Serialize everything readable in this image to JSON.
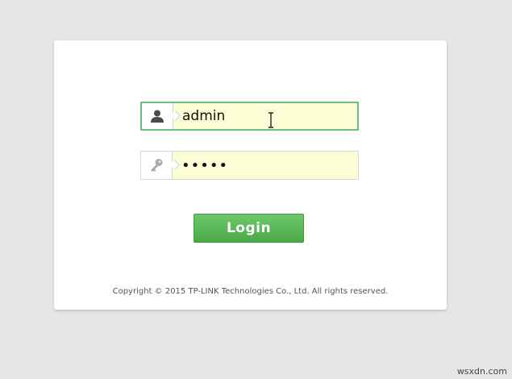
{
  "login_form": {
    "username": {
      "icon": "user-icon",
      "value": "admin"
    },
    "password": {
      "icon": "key-icon",
      "value": "•••••"
    },
    "login_button_label": "Login",
    "copyright": "Copyright © 2015 TP-LINK Technologies Co., Ltd. All rights reserved."
  },
  "watermark": "wsxdn.com",
  "colors": {
    "background": "#e6e6e6",
    "card": "#ffffff",
    "field_fill": "#fbfdd4",
    "focus_border": "#6cbf7d",
    "button_green": "#4caf50"
  }
}
